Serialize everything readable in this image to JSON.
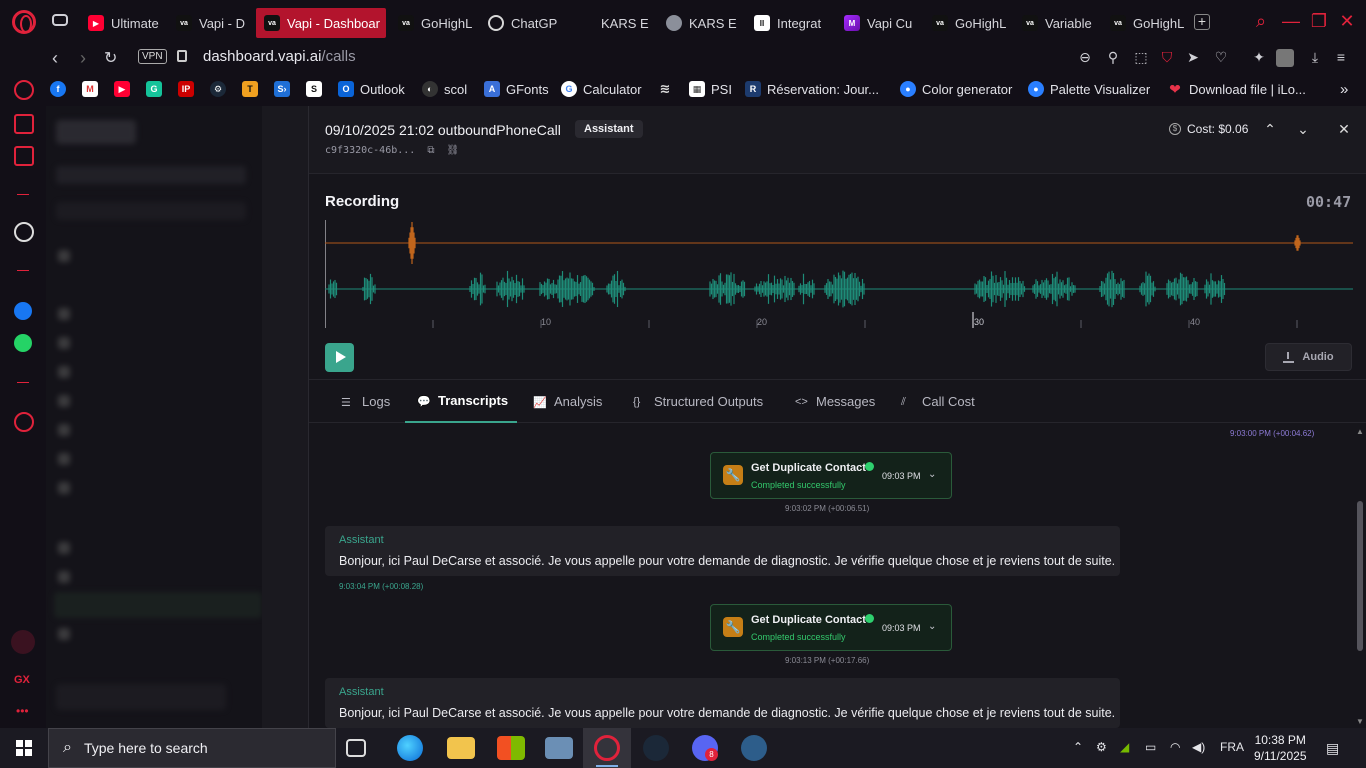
{
  "browser": {
    "tabs": [
      {
        "label": "Ultimate",
        "icon": "youtube-icon"
      },
      {
        "label": "Vapi - D",
        "icon": "vapi-icon"
      },
      {
        "label": "Vapi - Dashboar",
        "icon": "vapi-icon",
        "active": true
      },
      {
        "label": "GoHighL",
        "icon": "vapi-icon"
      },
      {
        "label": "ChatGP",
        "icon": "chatgpt-icon"
      },
      {
        "label": "KARS E",
        "icon": "blank-icon"
      },
      {
        "label": "KARS E",
        "icon": "globe-icon"
      },
      {
        "label": "Integrat",
        "icon": "integration-icon"
      },
      {
        "label": "Vapi Cu",
        "icon": "vapi-custom-icon"
      },
      {
        "label": "GoHighL",
        "icon": "vapi-icon"
      },
      {
        "label": "Variable",
        "icon": "vapi-icon"
      },
      {
        "label": "GoHighL",
        "icon": "vapi-icon"
      }
    ],
    "url_domain": "dashboard.vapi.ai",
    "url_path": "/calls",
    "vpn_label": "VPN",
    "bookmarks": [
      {
        "label": "",
        "icon": "facebook-icon"
      },
      {
        "label": "",
        "icon": "gmail-icon"
      },
      {
        "label": "",
        "icon": "youtube-icon"
      },
      {
        "label": "",
        "icon": "grammarly-icon"
      },
      {
        "label": "",
        "icon": "ip-icon"
      },
      {
        "label": "",
        "icon": "steam-icon"
      },
      {
        "label": "",
        "icon": "t-icon"
      },
      {
        "label": "",
        "icon": "s-arrow-icon"
      },
      {
        "label": "",
        "icon": "s-icon"
      },
      {
        "label": "Outlook",
        "icon": "outlook-icon"
      },
      {
        "label": "scol",
        "icon": "scol-icon"
      },
      {
        "label": "GFonts",
        "icon": "gfonts-icon"
      },
      {
        "label": "Calculator",
        "icon": "google-icon"
      },
      {
        "label": "",
        "icon": "stack-icon"
      },
      {
        "label": "PSI",
        "icon": "psi-icon"
      },
      {
        "label": "Réservation: Jour...",
        "icon": "r-icon"
      },
      {
        "label": "Color generator",
        "icon": "color-icon"
      },
      {
        "label": "Palette Visualizer",
        "icon": "palette-icon"
      },
      {
        "label": "Download file | iLo...",
        "icon": "heart-icon"
      }
    ]
  },
  "call": {
    "title": "09/10/2025 21:02 outboundPhoneCall",
    "badge": "Assistant",
    "id": "c9f3320c-46b...",
    "cost_label": "Cost: $0.06"
  },
  "recording": {
    "title": "Recording",
    "duration": "00:47",
    "ticks": [
      "10",
      "20",
      "30",
      "40"
    ],
    "audio_label": "Audio"
  },
  "tabs": [
    {
      "label": "Logs",
      "icon": "list-icon"
    },
    {
      "label": "Transcripts",
      "icon": "chat-icon",
      "active": true
    },
    {
      "label": "Analysis",
      "icon": "chart-icon"
    },
    {
      "label": "Structured Outputs",
      "icon": "braces-icon"
    },
    {
      "label": "Messages",
      "icon": "code-icon"
    },
    {
      "label": "Call Cost",
      "icon": "cost-chart-icon"
    }
  ],
  "transcript": {
    "top_stamp": "9:03:00 PM (+00:04.62)",
    "tool1": {
      "name": "Get Duplicate Contact",
      "status": "Completed successfully",
      "time": "09:03 PM",
      "stamp": "9:03:02 PM (+00:06.51)"
    },
    "msg1": {
      "role": "Assistant",
      "text": "Bonjour, ici Paul DeCarse et associé. Je vous appelle pour votre demande de diagnostic. Je vérifie quelque chose et je reviens tout de suite.",
      "stamp": "9:03:04 PM (+00:08.28)"
    },
    "tool2": {
      "name": "Get Duplicate Contact",
      "status": "Completed successfully",
      "time": "09:03 PM",
      "stamp": "9:03:13 PM (+00:17.66)"
    },
    "msg2": {
      "role": "Assistant",
      "text": "Bonjour, ici Paul DeCarse et associé. Je vous appelle pour votre demande de diagnostic. Je vérifie quelque chose et je reviens tout de suite."
    }
  },
  "taskbar": {
    "search_placeholder": "Type here to search",
    "lang": "FRA",
    "time": "10:38 PM",
    "date": "9/11/2025",
    "notif_badge": "8"
  }
}
